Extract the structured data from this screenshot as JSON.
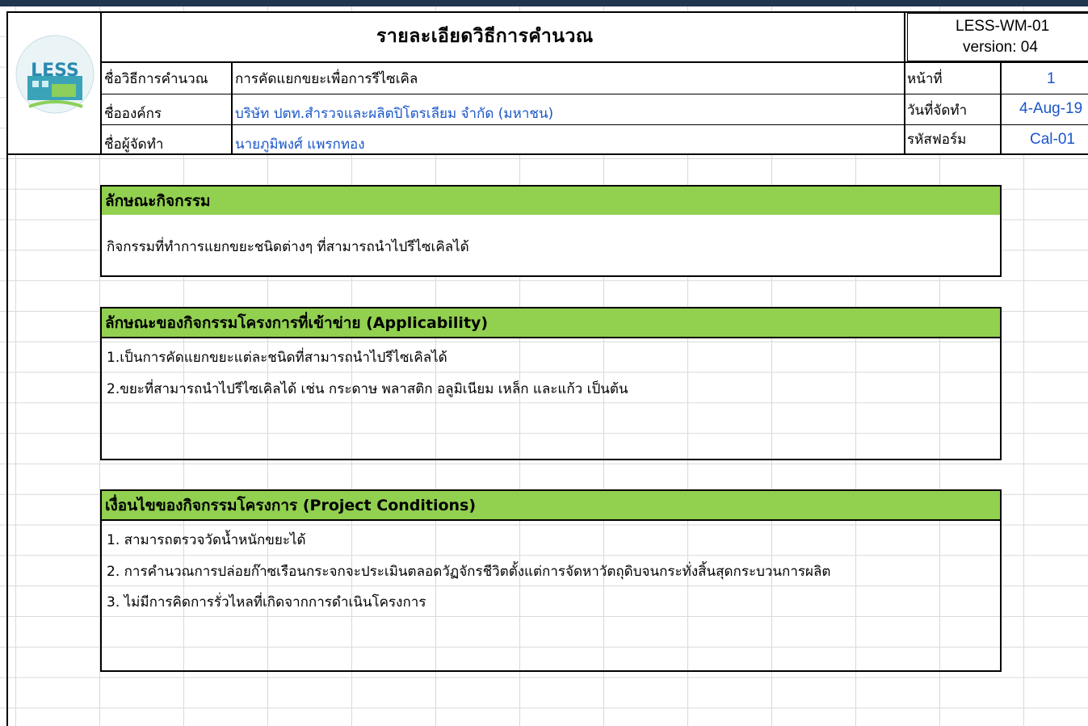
{
  "header": {
    "title": "รายละเอียดวิธีการคำนวณ",
    "doc_code": "LESS-WM-01",
    "version": "version: 04",
    "logo_text": "LESS",
    "method_label": "ชื่อวิธีการคำนวณ",
    "method_value": "การคัดแยกขยะเพื่อการรีไซเคิล",
    "org_label": "ชื่อองค์กร",
    "org_value": "บริษัท ปตท.สำรวจและผลิตปิโตรเลียม จำกัด (มหาชน)",
    "author_label": "ชื่อผู้จัดทำ",
    "author_value": "นายภูมิพงศ์ แพรกทอง",
    "page_label": "หน้าที่",
    "page_value": "1",
    "date_label": "วันที่จัดทำ",
    "date_value": "4-Aug-19",
    "form_label": "รหัสฟอร์ม",
    "form_value": "Cal-01"
  },
  "section1": {
    "heading": "ลักษณะกิจกรรม",
    "lines": [
      "กิจกรรมที่ทำการแยกขยะชนิดต่างๆ ที่สามารถนำไปรีไซเคิลได้"
    ]
  },
  "section2": {
    "heading": "ลักษณะของกิจกรรมโครงการที่เข้าข่าย (Applicability)",
    "lines": [
      "1.เป็นการคัดแยกขยะแต่ละชนิดที่สามารถนำไปรีไซเคิลได้",
      "2.ขยะที่สามารถนำไปรีไซเคิลได้ เช่น กระดาษ พลาสติก อลูมิเนียม เหล็ก และแก้ว เป็นต้น"
    ]
  },
  "section3": {
    "heading": "เงื่อนไขของกิจกรรมโครงการ (Project Conditions)",
    "lines": [
      "1. สามารถตรวจวัดน้ำหนักขยะได้",
      "2. การคำนวณการปล่อยก๊าซเรือนกระจกจะประเมินตลอดวัฏจักรชีวิตตั้งแต่การจัดหาวัตถุดิบจนกระทั่งสิ้นสุดกระบวนการผลิต",
      "3. ไม่มีการคิดการรั่วไหลที่เกิดจากการดำเนินโครงการ"
    ]
  },
  "colors": {
    "section_header_bg": "#92d050",
    "link_blue": "#1a56c9",
    "top_bar": "#1f3550"
  }
}
